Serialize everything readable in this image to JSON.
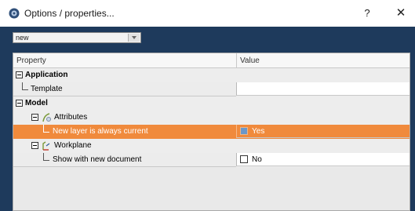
{
  "window": {
    "title": "Options / properties...",
    "help_label": "?",
    "close_label": "✕"
  },
  "profile": {
    "selected": "new"
  },
  "grid": {
    "col_property": "Property",
    "col_value": "Value",
    "application": {
      "label": "Application",
      "template_label": "Template",
      "template_value": ""
    },
    "model": {
      "label": "Model",
      "attributes": {
        "label": "Attributes",
        "new_layer_label": "New layer is always current",
        "new_layer_value": "Yes"
      },
      "workplane": {
        "label": "Workplane",
        "show_label": "Show with new document",
        "show_value": "No"
      }
    }
  },
  "colors": {
    "content_bg": "#1e3a5c",
    "selection": "#f08a3c"
  },
  "icons": [
    "app-icon",
    "help-icon",
    "close-icon",
    "chevron-down-icon",
    "collapse-icon",
    "attributes-icon",
    "workplane-icon",
    "checkbox-icon"
  ]
}
